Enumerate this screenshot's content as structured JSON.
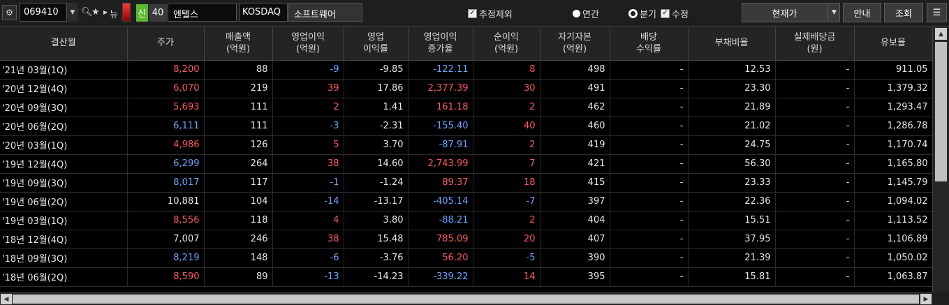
{
  "toolbar": {
    "settings_icon": "gear-icon",
    "stock_code": "069410",
    "dropdown_icon": "chevron-down-icon",
    "search_icon": "search-icon",
    "star_icon": "star-icon",
    "next_icon": "triangle-right-icon",
    "news_label": "뉴",
    "sin_label": "신",
    "sin_number": "40",
    "company_name": "엔텔스",
    "market": "KOSDAQ",
    "sector": "소프트웨어",
    "exclude_estimate_label": "추정제외",
    "annual_label": "연간",
    "quarter_label": "분기",
    "revised_label": "수정",
    "price_type": "현재가",
    "guide_button": "안내",
    "query_button": "조회",
    "menu_icon": "list-icon"
  },
  "table": {
    "headers": [
      [
        "결산월"
      ],
      [
        "주가"
      ],
      [
        "매출액",
        "(억원)"
      ],
      [
        "영업이익",
        "(억원)"
      ],
      [
        "영업",
        "이익률"
      ],
      [
        "영업이익",
        "증가율"
      ],
      [
        "순이익",
        "(억원)"
      ],
      [
        "자기자본",
        "(억원)"
      ],
      [
        "배당",
        "수익률"
      ],
      [
        "부채비율"
      ],
      [
        "실제배당금",
        "(원)"
      ],
      [
        "유보율"
      ]
    ],
    "rows": [
      {
        "period": "'21년 03월(1Q)",
        "price": "8,200",
        "price_dir": "up",
        "sales": "88",
        "op": "-9",
        "op_dir": "down",
        "op_margin": "-9.85",
        "op_growth": "-122.11",
        "growth_dir": "down",
        "net": "8",
        "net_dir": "up",
        "equity": "498",
        "div_yield": "-",
        "debt": "12.53",
        "dividend": "-",
        "reserve": "911.05"
      },
      {
        "period": "'20년 12월(4Q)",
        "price": "6,070",
        "price_dir": "up",
        "sales": "219",
        "op": "39",
        "op_dir": "up",
        "op_margin": "17.86",
        "op_growth": "2,377.39",
        "growth_dir": "up",
        "net": "30",
        "net_dir": "up",
        "equity": "491",
        "div_yield": "-",
        "debt": "23.30",
        "dividend": "-",
        "reserve": "1,379.32"
      },
      {
        "period": "'20년 09월(3Q)",
        "price": "5,693",
        "price_dir": "up",
        "sales": "111",
        "op": "2",
        "op_dir": "up",
        "op_margin": "1.41",
        "op_growth": "161.18",
        "growth_dir": "up",
        "net": "2",
        "net_dir": "up",
        "equity": "462",
        "div_yield": "-",
        "debt": "21.89",
        "dividend": "-",
        "reserve": "1,293.47"
      },
      {
        "period": "'20년 06월(2Q)",
        "price": "6,111",
        "price_dir": "down",
        "sales": "111",
        "op": "-3",
        "op_dir": "down",
        "op_margin": "-2.31",
        "op_growth": "-155.40",
        "growth_dir": "down",
        "net": "40",
        "net_dir": "up",
        "equity": "460",
        "div_yield": "-",
        "debt": "21.02",
        "dividend": "-",
        "reserve": "1,286.78"
      },
      {
        "period": "'20년 03월(1Q)",
        "price": "4,986",
        "price_dir": "up",
        "sales": "126",
        "op": "5",
        "op_dir": "up",
        "op_margin": "3.70",
        "op_growth": "-87.91",
        "growth_dir": "down",
        "net": "2",
        "net_dir": "up",
        "equity": "419",
        "div_yield": "-",
        "debt": "24.75",
        "dividend": "-",
        "reserve": "1,170.74"
      },
      {
        "period": "'19년 12월(4Q)",
        "price": "6,299",
        "price_dir": "down",
        "sales": "264",
        "op": "38",
        "op_dir": "up",
        "op_margin": "14.60",
        "op_growth": "2,743.99",
        "growth_dir": "up",
        "net": "7",
        "net_dir": "up",
        "equity": "421",
        "div_yield": "-",
        "debt": "56.30",
        "dividend": "-",
        "reserve": "1,165.80"
      },
      {
        "period": "'19년 09월(3Q)",
        "price": "8,017",
        "price_dir": "down",
        "sales": "117",
        "op": "-1",
        "op_dir": "down",
        "op_margin": "-1.24",
        "op_growth": "89.37",
        "growth_dir": "up",
        "net": "18",
        "net_dir": "up",
        "equity": "415",
        "div_yield": "-",
        "debt": "23.33",
        "dividend": "-",
        "reserve": "1,145.79"
      },
      {
        "period": "'19년 06월(2Q)",
        "price": "10,881",
        "price_dir": "flat",
        "sales": "104",
        "op": "-14",
        "op_dir": "down",
        "op_margin": "-13.17",
        "op_growth": "-405.14",
        "growth_dir": "down",
        "net": "-7",
        "net_dir": "down",
        "equity": "397",
        "div_yield": "-",
        "debt": "22.36",
        "dividend": "-",
        "reserve": "1,094.02"
      },
      {
        "period": "'19년 03월(1Q)",
        "price": "8,556",
        "price_dir": "up",
        "sales": "118",
        "op": "4",
        "op_dir": "up",
        "op_margin": "3.80",
        "op_growth": "-88.21",
        "growth_dir": "down",
        "net": "2",
        "net_dir": "up",
        "equity": "404",
        "div_yield": "-",
        "debt": "15.51",
        "dividend": "-",
        "reserve": "1,113.52"
      },
      {
        "period": "'18년 12월(4Q)",
        "price": "7,007",
        "price_dir": "flat",
        "sales": "246",
        "op": "38",
        "op_dir": "up",
        "op_margin": "15.48",
        "op_growth": "785.09",
        "growth_dir": "up",
        "net": "20",
        "net_dir": "up",
        "equity": "407",
        "div_yield": "-",
        "debt": "37.95",
        "dividend": "-",
        "reserve": "1,106.89"
      },
      {
        "period": "'18년 09월(3Q)",
        "price": "8,219",
        "price_dir": "down",
        "sales": "148",
        "op": "-6",
        "op_dir": "down",
        "op_margin": "-3.76",
        "op_growth": "56.20",
        "growth_dir": "up",
        "net": "-5",
        "net_dir": "down",
        "equity": "390",
        "div_yield": "-",
        "debt": "21.39",
        "dividend": "-",
        "reserve": "1,050.02"
      },
      {
        "period": "'18년 06월(2Q)",
        "price": "8,590",
        "price_dir": "up",
        "sales": "89",
        "op": "-13",
        "op_dir": "down",
        "op_margin": "-14.23",
        "op_growth": "-339.22",
        "growth_dir": "down",
        "net": "14",
        "net_dir": "up",
        "equity": "395",
        "div_yield": "-",
        "debt": "15.81",
        "dividend": "-",
        "reserve": "1,063.87"
      }
    ]
  },
  "colors": {
    "up": "#ff5a5a",
    "down": "#6aa6ff",
    "flat": "#e6e6e6",
    "background": "#000000",
    "header": "#242424"
  }
}
